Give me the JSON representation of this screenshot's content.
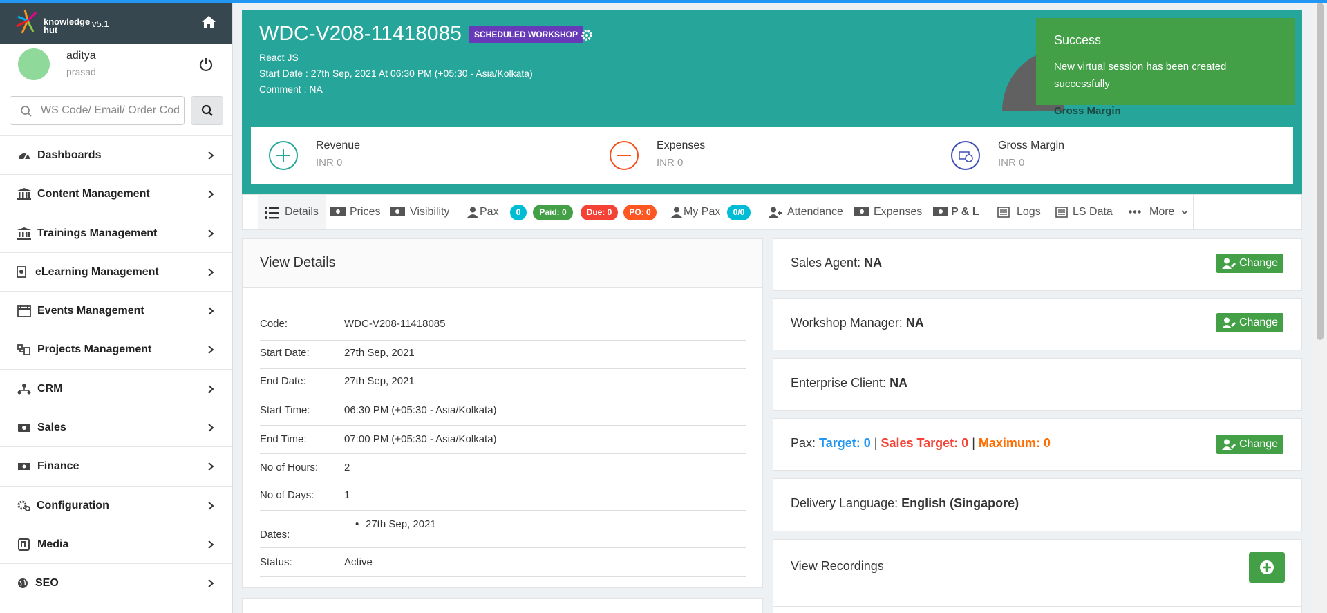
{
  "app": {
    "brand_top": "knowledge",
    "brand_bottom": "hut",
    "version": "v5.1"
  },
  "user": {
    "name": "aditya",
    "sub": "prasad"
  },
  "search": {
    "placeholder": "WS Code/ Email/ Order Code"
  },
  "nav": [
    {
      "label": "Dashboards",
      "icon": "dashboard-icon"
    },
    {
      "label": "Content Management",
      "icon": "institution-icon"
    },
    {
      "label": "Trainings Management",
      "icon": "institution-icon"
    },
    {
      "label": "eLearning Management",
      "icon": "elearning-icon"
    },
    {
      "label": "Events Management",
      "icon": "calendar-icon"
    },
    {
      "label": "Projects Management",
      "icon": "projects-icon"
    },
    {
      "label": "CRM",
      "icon": "crm-icon"
    },
    {
      "label": "Sales",
      "icon": "sales-icon"
    },
    {
      "label": "Finance",
      "icon": "finance-icon"
    },
    {
      "label": "Configuration",
      "icon": "cogs-icon"
    },
    {
      "label": "Media",
      "icon": "media-icon"
    },
    {
      "label": "SEO",
      "icon": "globe-icon"
    }
  ],
  "header": {
    "code": "WDC-V208-11418085",
    "badge": "SCHEDULED WORKSHOP",
    "course": "React JS",
    "start": "Start Date : 27th Sep, 2021 At 06:30 PM (+05:30 - Asia/Kolkata)",
    "comment": "Comment : NA",
    "gross_margin_label": "Gross Margin"
  },
  "toast": {
    "title": "Success",
    "message": "New virtual session has been created successfully"
  },
  "kpis": [
    {
      "label": "Revenue",
      "value": "INR 0",
      "color": "#26a69a"
    },
    {
      "label": "Expenses",
      "value": "INR 0",
      "color": "#f4511e"
    },
    {
      "label": "Gross Margin",
      "value": "INR 0",
      "color": "#3f51b5"
    }
  ],
  "tabs": {
    "details": "Details",
    "prices": "Prices",
    "visibility": "Visibility",
    "pax": "Pax",
    "pax_count": "0",
    "paid": "Paid: 0",
    "due": "Due: 0",
    "po": "PO: 0",
    "my_pax": "My Pax",
    "my_pax_count": "0/0",
    "attendance": "Attendance",
    "expenses": "Expenses",
    "pl": "P & L",
    "logs": "Logs",
    "ls_data": "LS Data",
    "more": "More"
  },
  "details": {
    "title": "View Details",
    "rows": [
      {
        "k": "Code:",
        "v": "WDC-V208-11418085"
      },
      {
        "k": "Start Date:",
        "v": "27th Sep, 2021"
      },
      {
        "k": "End Date:",
        "v": "27th Sep, 2021"
      },
      {
        "k": "Start Time:",
        "v": "06:30 PM (+05:30 - Asia/Kolkata)"
      },
      {
        "k": "End Time:",
        "v": "07:00 PM (+05:30 - Asia/Kolkata)"
      },
      {
        "k": "No of Hours:",
        "v": "2"
      },
      {
        "k": "No of Days:",
        "v": "1"
      },
      {
        "k": "Dates:",
        "v": "27th Sep, 2021"
      },
      {
        "k": "Status:",
        "v": "Active"
      }
    ]
  },
  "cards": {
    "sales_agent_label": "Sales Agent:",
    "sales_agent_value": "NA",
    "workshop_manager_label": "Workshop Manager:",
    "workshop_manager_value": "NA",
    "enterprise_label": "Enterprise Client:",
    "enterprise_value": "NA",
    "pax_label": "Pax:",
    "pax_target": "Target: 0",
    "pax_sales_target": "Sales Target: 0",
    "pax_maximum": "Maximum: 0",
    "pax_sep": "|",
    "language_label": "Delivery Language:",
    "language_value": "English (Singapore)",
    "recordings_title": "View Recordings",
    "change_label": "Change"
  }
}
